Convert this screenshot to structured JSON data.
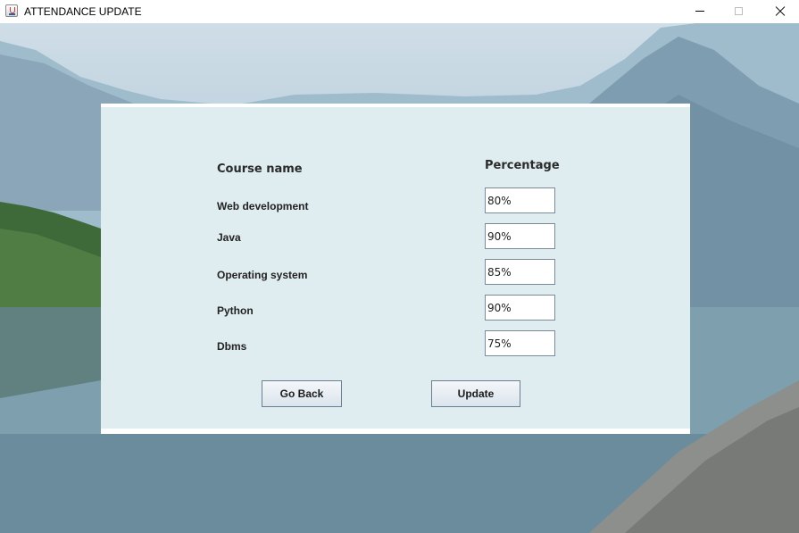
{
  "window": {
    "title": "ATTENDANCE UPDATE",
    "icon": "java-app-icon"
  },
  "form": {
    "headers": {
      "course": "Course name",
      "percentage": "Percentage"
    },
    "rows": [
      {
        "course": "Web development",
        "percentage": "80%"
      },
      {
        "course": "Java",
        "percentage": "90%"
      },
      {
        "course": "Operating system",
        "percentage": "85%"
      },
      {
        "course": "Python",
        "percentage": "90%"
      },
      {
        "course": "Dbms",
        "percentage": "75%"
      }
    ],
    "buttons": {
      "back": "Go Back",
      "update": "Update"
    }
  },
  "colors": {
    "panel_background": "#dfedf1",
    "button_border": "#6b7f94"
  }
}
